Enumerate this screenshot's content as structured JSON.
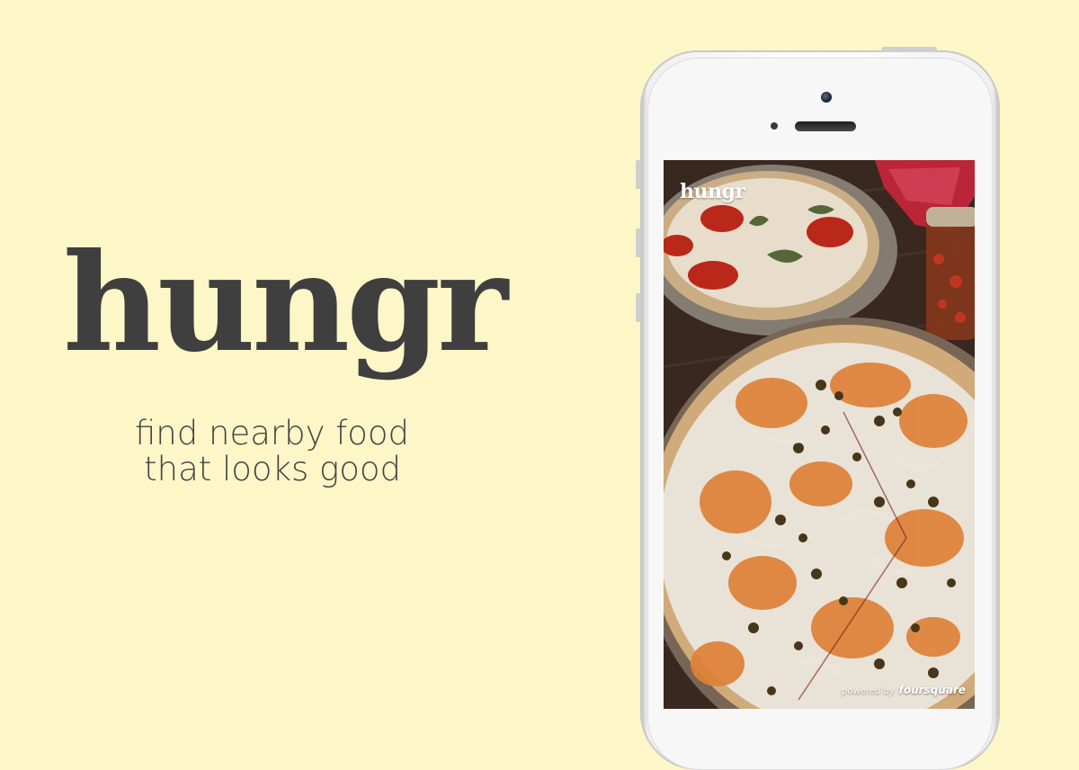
{
  "hero": {
    "logo": "hungr",
    "tagline_line1": "find nearby food",
    "tagline_line2": "that looks good"
  },
  "phone_screen": {
    "app_logo": "hungr",
    "powered_by_label": "powered by",
    "powered_by_brand": "foursquare",
    "photo_subject": "pizza"
  },
  "colors": {
    "background": "#fdf7c7",
    "logo_text": "#3f3f3f",
    "tagline_text": "#444444",
    "app_logo_text": "#ffffff"
  }
}
